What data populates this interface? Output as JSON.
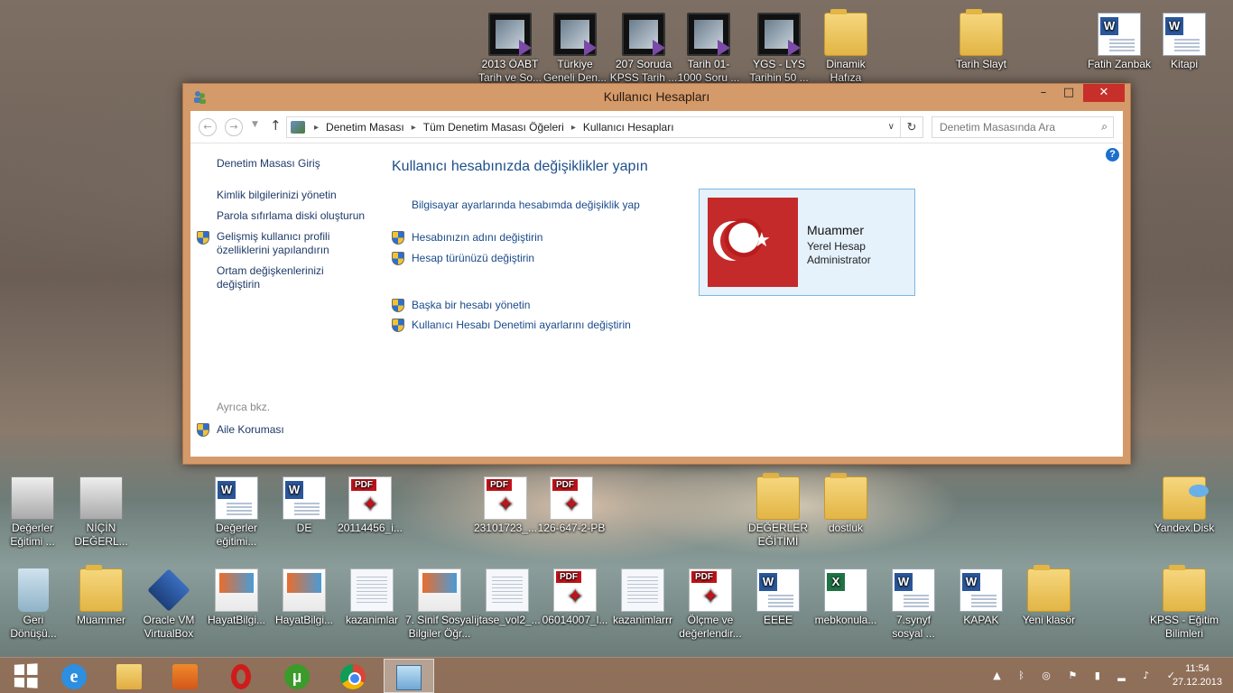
{
  "desktop": {
    "top_icons": [
      {
        "label": "2013 ÖABT\nTarih ve So...",
        "type": "video"
      },
      {
        "label": "Türkiye\nGeneli Den...",
        "type": "video"
      },
      {
        "label": "207 Soruda\nKPSS Tarih ...",
        "type": "video"
      },
      {
        "label": "Tarih 01-\n1000 Soru ...",
        "type": "video"
      },
      {
        "label": "YGS - LYS\nTarihin 50 ...",
        "type": "video"
      },
      {
        "label": "Dinamik\nHafıza",
        "type": "folder"
      },
      {
        "label": "Tarih Slayt",
        "type": "folder"
      },
      {
        "label": "Fatih Zanbak",
        "type": "word"
      },
      {
        "label": "Kitapi",
        "type": "word"
      }
    ],
    "middle_icons": [
      {
        "label": "Değerler\nEğitimi ...",
        "type": "thumb"
      },
      {
        "label": "NİÇİN\nDEĞERL...",
        "type": "thumb"
      },
      {
        "label": "Değerler\neğitimi...",
        "type": "word"
      },
      {
        "label": "DE",
        "type": "word"
      },
      {
        "label": "20114456_i...",
        "type": "pdf"
      },
      {
        "label": "23101723_...",
        "type": "pdf"
      },
      {
        "label": "126-647-2-PB",
        "type": "pdf"
      },
      {
        "label": "DEĞERLER\nEĞİTİMİ",
        "type": "folder"
      },
      {
        "label": "dostluk",
        "type": "folder"
      },
      {
        "label": "Yandex.Disk",
        "type": "yandex"
      }
    ],
    "bottom_icons": [
      {
        "label": "Geri\nDönüşü...",
        "type": "bin"
      },
      {
        "label": "Muammer",
        "type": "folder"
      },
      {
        "label": "Oracle VM\nVirtualBox",
        "type": "vbox"
      },
      {
        "label": "HayatBilgi...",
        "type": "book"
      },
      {
        "label": "HayatBilgi...",
        "type": "book"
      },
      {
        "label": "kazanimlar",
        "type": "doc"
      },
      {
        "label": "7. Sinif Sosyal\nBilgiler Öğr...",
        "type": "book"
      },
      {
        "label": "ijtase_vol2_...",
        "type": "doc"
      },
      {
        "label": "06014007_l...",
        "type": "pdf"
      },
      {
        "label": "kazanimlarrr",
        "type": "doc"
      },
      {
        "label": "Ölçme ve\ndeğerlendir...",
        "type": "pdf"
      },
      {
        "label": "EEEE",
        "type": "word"
      },
      {
        "label": "mebkonula...",
        "type": "excel"
      },
      {
        "label": "7.synyf\nsosyal ...",
        "type": "word"
      },
      {
        "label": "KAPAK",
        "type": "word"
      },
      {
        "label": "Yeni klasör",
        "type": "folder"
      },
      {
        "label": "KPSS - Eğitim\nBilimleri",
        "type": "folder"
      }
    ]
  },
  "window": {
    "title": "Kullanıcı Hesapları",
    "controls": {
      "minimize": "–",
      "maximize": "□",
      "close": "✕"
    },
    "breadcrumbs": [
      "Denetim Masası",
      "Tüm Denetim Masası Öğeleri",
      "Kullanıcı Hesapları"
    ],
    "search_placeholder": "Denetim Masasında Ara",
    "sidebar": {
      "home": "Denetim Masası Giriş",
      "links": [
        {
          "label": "Kimlik bilgilerinizi yönetin",
          "shield": false
        },
        {
          "label": "Parola sıfırlama diski oluşturun",
          "shield": false
        },
        {
          "label": "Gelişmiş kullanıcı profili\nözelliklerini yapılandırın",
          "shield": true
        },
        {
          "label": "Ortam değişkenlerinizi\ndeğiştirin",
          "shield": false
        }
      ],
      "see_also": "Ayrıca bkz.",
      "family": "Aile Koruması"
    },
    "main": {
      "heading": "Kullanıcı hesabınızda değişiklikler yapın",
      "pc_settings": "Bilgisayar ayarlarında hesabımda değişiklik yap",
      "change_name": "Hesabınızın adını değiştirin",
      "change_type": "Hesap türünüzü değiştirin",
      "manage_other": "Başka bir hesabı yönetin",
      "uac": "Kullanıcı Hesabı Denetimi ayarlarını değiştirin"
    },
    "user": {
      "name": "Muammer",
      "account_type": "Yerel Hesap",
      "role": "Administrator"
    }
  },
  "taskbar": {
    "apps": [
      "start",
      "internet-explorer",
      "file-explorer",
      "media-player",
      "opera",
      "utorrent",
      "chrome",
      "control-panel"
    ],
    "active": "control-panel",
    "time": "11:54",
    "date": "27.12.2013"
  }
}
